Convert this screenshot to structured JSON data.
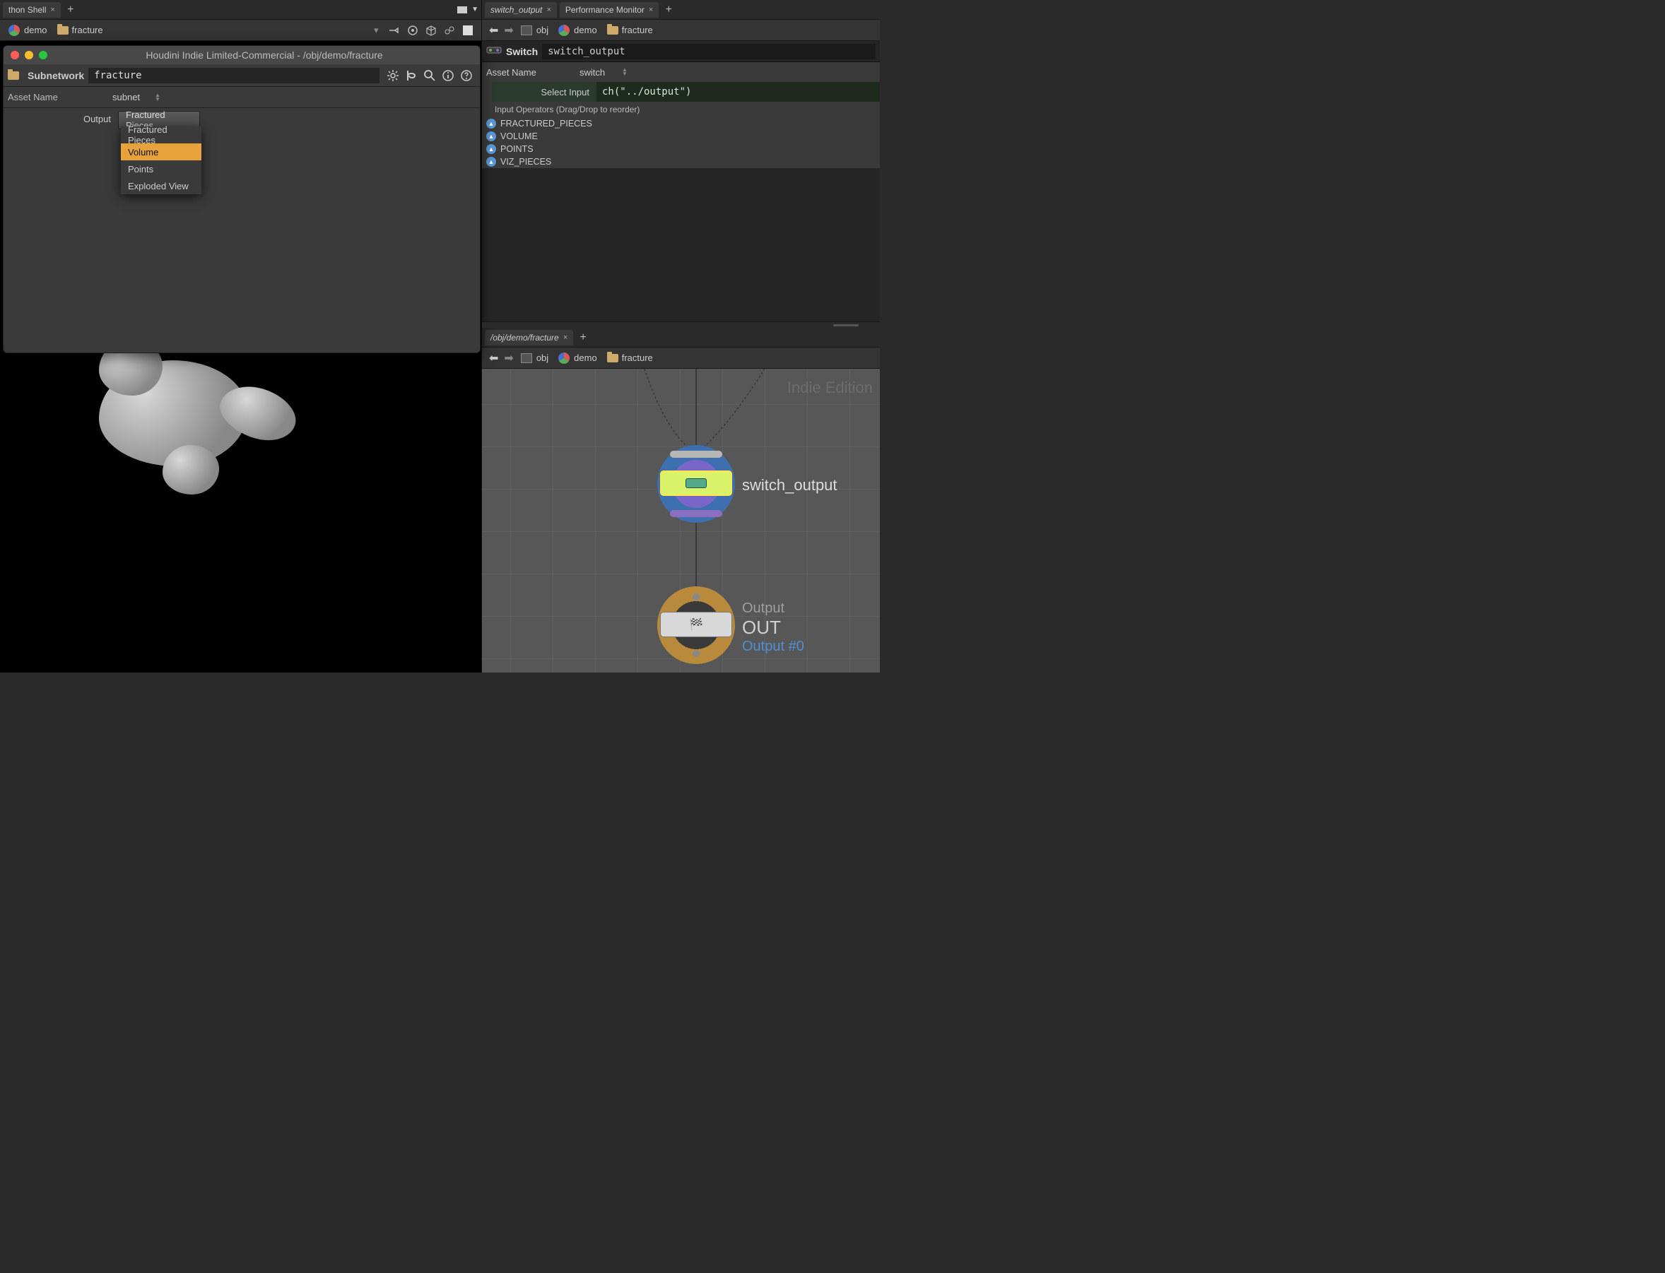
{
  "left": {
    "tabs": [
      {
        "label": "thon Shell",
        "closeable": true
      }
    ],
    "path": {
      "items": [
        {
          "label": "demo",
          "icon": "geo"
        },
        {
          "label": "fracture",
          "icon": "folder"
        }
      ]
    },
    "param_window": {
      "title": "Houdini Indie Limited-Commercial - /obj/demo/fracture",
      "op_type": "Subnetwork",
      "op_name": "fracture",
      "asset_name_label": "Asset Name",
      "asset_type": "subnet",
      "output_label": "Output",
      "output_value": "Fractured Pieces",
      "output_options": [
        "Fractured Pieces",
        "Volume",
        "Points",
        "Exploded View"
      ],
      "output_hover_index": 1
    }
  },
  "right_top": {
    "tabs": [
      {
        "label": "switch_output",
        "closeable": true
      },
      {
        "label": "Performance Monitor",
        "closeable": true
      }
    ],
    "path": {
      "obj_label": "obj",
      "items": [
        {
          "label": "demo",
          "icon": "geo"
        },
        {
          "label": "fracture",
          "icon": "folder"
        }
      ]
    },
    "node_type": "Switch",
    "node_name": "switch_output",
    "asset_name_label": "Asset Name",
    "asset_type": "switch",
    "select_input_label": "Select Input",
    "select_input_expr": "ch(\"../output\")",
    "reorder_header": "Input Operators (Drag/Drop to reorder)",
    "inputs": [
      "FRACTURED_PIECES",
      "VOLUME",
      "POINTS",
      "VIZ_PIECES"
    ]
  },
  "right_bottom": {
    "tab": {
      "label": "/obj/demo/fracture"
    },
    "path": {
      "obj_label": "obj",
      "items": [
        {
          "label": "demo",
          "icon": "geo"
        },
        {
          "label": "fracture",
          "icon": "folder"
        }
      ]
    },
    "watermark": "Indie Edition",
    "switch_node_label": "switch_output",
    "out_node": {
      "l1": "Output",
      "l2": "OUT",
      "l3": "Output #0"
    }
  }
}
